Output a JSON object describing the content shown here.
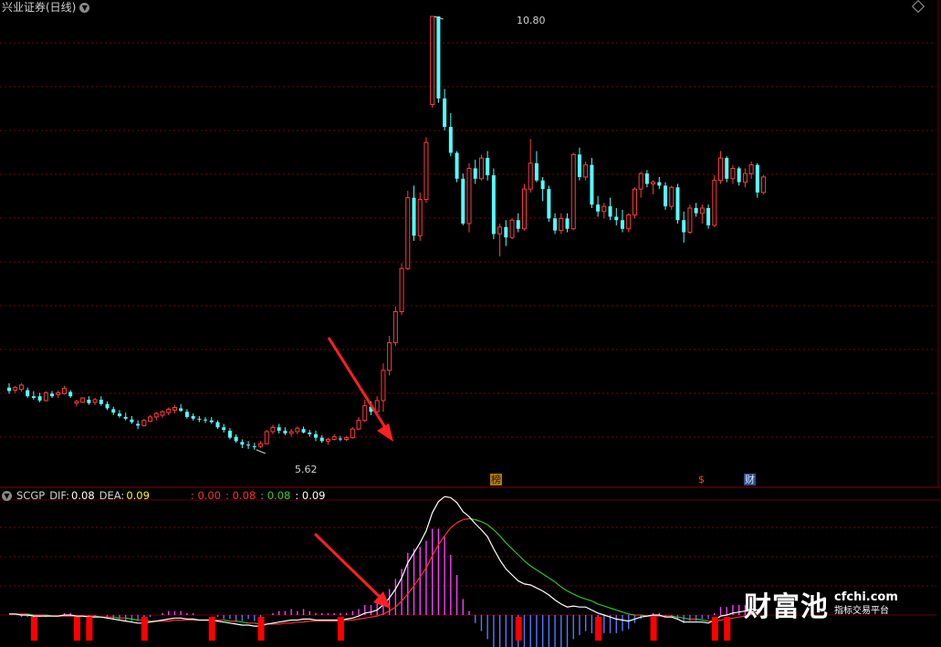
{
  "window": {
    "title": "兴业证券(日线)"
  },
  "indicator": {
    "name": "SCGP",
    "dif_label": "DIF:",
    "dif_value": "0.08",
    "dea_label": "DEA:",
    "dea_value": "0.09",
    "v1": ": 0.00",
    "v2": ": 0.08",
    "v3": ": 0.08",
    "v4": ": 0.09"
  },
  "price_labels": {
    "high": "10.80",
    "low": "5.62"
  },
  "markers": {
    "bang": "榜",
    "dollar": "$",
    "cai": "财"
  },
  "watermark": {
    "big": "财富池",
    "url": "cfchi.com",
    "tag": "指标交易平台"
  },
  "colors": {
    "up": "#ff3c3c",
    "down": "#54ffff",
    "grid": "#7a0000",
    "dif": "#ffffff",
    "dea": "#ffff00",
    "hist_pos": "#ff3cff",
    "hist_neg": "#4f7bff",
    "signal": "#ff0000",
    "arrow": "#ff2020"
  },
  "chart_data": {
    "type": "candlestick",
    "price_range": [
      5.62,
      10.8
    ],
    "candles": [
      [
        6.5,
        6.55,
        6.43,
        6.46
      ],
      [
        6.47,
        6.52,
        6.44,
        6.5
      ],
      [
        6.48,
        6.55,
        6.45,
        6.53
      ],
      [
        6.47,
        6.5,
        6.38,
        6.4
      ],
      [
        6.4,
        6.46,
        6.36,
        6.38
      ],
      [
        6.4,
        6.44,
        6.33,
        6.35
      ],
      [
        6.35,
        6.46,
        6.34,
        6.44
      ],
      [
        6.43,
        6.46,
        6.38,
        6.4
      ],
      [
        6.42,
        6.47,
        6.38,
        6.44
      ],
      [
        6.43,
        6.52,
        6.42,
        6.49
      ],
      [
        6.45,
        6.47,
        6.38,
        6.4
      ],
      [
        6.32,
        6.36,
        6.28,
        6.34
      ],
      [
        6.33,
        6.39,
        6.32,
        6.38
      ],
      [
        6.36,
        6.4,
        6.3,
        6.32
      ],
      [
        6.33,
        6.38,
        6.3,
        6.36
      ],
      [
        6.36,
        6.4,
        6.29,
        6.31
      ],
      [
        6.31,
        6.34,
        6.24,
        6.26
      ],
      [
        6.25,
        6.28,
        6.18,
        6.21
      ],
      [
        6.2,
        6.24,
        6.15,
        6.17
      ],
      [
        6.16,
        6.21,
        6.12,
        6.14
      ],
      [
        6.13,
        6.17,
        6.08,
        6.1
      ],
      [
        6.08,
        6.12,
        6.02,
        6.06
      ],
      [
        6.06,
        6.14,
        6.05,
        6.12
      ],
      [
        6.11,
        6.18,
        6.1,
        6.16
      ],
      [
        6.16,
        6.22,
        6.12,
        6.2
      ],
      [
        6.18,
        6.24,
        6.15,
        6.22
      ],
      [
        6.21,
        6.27,
        6.18,
        6.25
      ],
      [
        6.24,
        6.3,
        6.2,
        6.27
      ],
      [
        6.26,
        6.31,
        6.22,
        6.23
      ],
      [
        6.22,
        6.25,
        6.14,
        6.16
      ],
      [
        6.17,
        6.2,
        6.12,
        6.14
      ],
      [
        6.14,
        6.17,
        6.1,
        6.13
      ],
      [
        6.13,
        6.16,
        6.09,
        6.12
      ],
      [
        6.12,
        6.16,
        6.08,
        6.1
      ],
      [
        6.1,
        6.12,
        6.02,
        6.04
      ],
      [
        6.04,
        6.08,
        5.98,
        6.01
      ],
      [
        6.0,
        6.03,
        5.9,
        5.92
      ],
      [
        5.93,
        5.96,
        5.86,
        5.88
      ],
      [
        5.87,
        5.9,
        5.8,
        5.84
      ],
      [
        5.84,
        5.88,
        5.79,
        5.83
      ],
      [
        5.82,
        5.86,
        5.78,
        5.81
      ],
      [
        5.82,
        5.88,
        5.8,
        5.85
      ],
      [
        5.85,
        6.01,
        5.84,
        5.99
      ],
      [
        5.99,
        6.07,
        5.96,
        6.04
      ],
      [
        6.04,
        6.08,
        5.97,
        6.0
      ],
      [
        6.0,
        6.04,
        5.95,
        5.97
      ],
      [
        5.97,
        6.02,
        5.93,
        5.99
      ],
      [
        5.99,
        6.05,
        5.96,
        6.03
      ],
      [
        6.02,
        6.05,
        5.97,
        5.98
      ],
      [
        5.98,
        6.01,
        5.93,
        5.96
      ],
      [
        5.96,
        6.0,
        5.88,
        5.92
      ],
      [
        5.92,
        5.95,
        5.86,
        5.88
      ],
      [
        5.88,
        5.92,
        5.84,
        5.9
      ],
      [
        5.9,
        5.96,
        5.89,
        5.93
      ],
      [
        5.91,
        5.94,
        5.88,
        5.9
      ],
      [
        5.9,
        5.94,
        5.88,
        5.92
      ],
      [
        5.92,
        6.04,
        5.91,
        6.02
      ],
      [
        6.02,
        6.16,
        6.01,
        6.12
      ],
      [
        6.12,
        6.36,
        6.1,
        6.29
      ],
      [
        6.28,
        6.34,
        6.18,
        6.22
      ],
      [
        6.22,
        6.4,
        6.2,
        6.35
      ],
      [
        6.35,
        6.78,
        6.22,
        6.7
      ],
      [
        6.7,
        7.1,
        6.64,
        7.02
      ],
      [
        7.02,
        7.44,
        6.98,
        7.38
      ],
      [
        7.38,
        7.94,
        7.34,
        7.88
      ],
      [
        7.88,
        8.78,
        7.86,
        8.7
      ],
      [
        8.7,
        8.84,
        8.2,
        8.26
      ],
      [
        8.26,
        8.76,
        8.2,
        8.68
      ],
      [
        8.68,
        9.4,
        8.64,
        9.34
      ],
      [
        9.78,
        10.8,
        9.74,
        10.8
      ],
      [
        10.8,
        10.8,
        9.8,
        9.85
      ],
      [
        9.85,
        9.96,
        9.48,
        9.52
      ],
      [
        9.52,
        9.68,
        9.18,
        9.22
      ],
      [
        9.22,
        9.24,
        8.88,
        8.92
      ],
      [
        8.92,
        8.98,
        8.38,
        8.4
      ],
      [
        8.4,
        9.1,
        8.3,
        9.04
      ],
      [
        9.04,
        9.14,
        8.86,
        8.92
      ],
      [
        8.92,
        9.2,
        8.9,
        9.16
      ],
      [
        9.16,
        9.24,
        8.9,
        8.96
      ],
      [
        8.96,
        9.04,
        8.22,
        8.28
      ],
      [
        8.28,
        8.4,
        8.02,
        8.36
      ],
      [
        8.36,
        8.44,
        8.14,
        8.24
      ],
      [
        8.24,
        8.46,
        8.22,
        8.44
      ],
      [
        8.44,
        8.52,
        8.3,
        8.34
      ],
      [
        8.34,
        8.86,
        8.32,
        8.8
      ],
      [
        8.8,
        9.38,
        8.76,
        9.1
      ],
      [
        9.1,
        9.24,
        8.88,
        8.9
      ],
      [
        8.9,
        8.94,
        8.66,
        8.8
      ],
      [
        8.8,
        8.84,
        8.42,
        8.46
      ],
      [
        8.46,
        8.52,
        8.28,
        8.32
      ],
      [
        8.32,
        8.52,
        8.28,
        8.46
      ],
      [
        8.46,
        8.52,
        8.3,
        8.34
      ],
      [
        8.34,
        9.22,
        8.32,
        9.2
      ],
      [
        9.2,
        9.28,
        8.9,
        8.94
      ],
      [
        8.94,
        9.12,
        8.9,
        9.08
      ],
      [
        9.08,
        9.16,
        8.58,
        8.62
      ],
      [
        8.62,
        8.72,
        8.48,
        8.54
      ],
      [
        8.54,
        8.64,
        8.46,
        8.6
      ],
      [
        8.6,
        8.7,
        8.44,
        8.48
      ],
      [
        8.48,
        8.58,
        8.38,
        8.44
      ],
      [
        8.44,
        8.56,
        8.3,
        8.34
      ],
      [
        8.34,
        8.52,
        8.3,
        8.5
      ],
      [
        8.5,
        8.82,
        8.46,
        8.8
      ],
      [
        8.8,
        9.0,
        8.7,
        8.98
      ],
      [
        8.98,
        9.02,
        8.82,
        8.86
      ],
      [
        8.86,
        8.9,
        8.74,
        8.88
      ],
      [
        8.88,
        8.94,
        8.8,
        8.84
      ],
      [
        8.84,
        8.88,
        8.56,
        8.6
      ],
      [
        8.6,
        8.84,
        8.56,
        8.82
      ],
      [
        8.82,
        8.86,
        8.4,
        8.44
      ],
      [
        8.44,
        8.54,
        8.18,
        8.3
      ],
      [
        8.3,
        8.62,
        8.28,
        8.58
      ],
      [
        8.58,
        8.64,
        8.48,
        8.52
      ],
      [
        8.52,
        8.62,
        8.4,
        8.58
      ],
      [
        8.58,
        8.62,
        8.34,
        8.38
      ],
      [
        8.38,
        8.96,
        8.36,
        8.9
      ],
      [
        8.9,
        9.24,
        8.86,
        9.16
      ],
      [
        9.16,
        9.18,
        8.88,
        8.92
      ],
      [
        8.92,
        9.08,
        8.86,
        9.04
      ],
      [
        9.04,
        9.06,
        8.84,
        8.88
      ],
      [
        8.88,
        9.04,
        8.82,
        8.98
      ],
      [
        8.98,
        9.12,
        8.92,
        9.08
      ],
      [
        9.08,
        9.1,
        8.7,
        8.76
      ],
      [
        8.76,
        8.96,
        8.74,
        8.94
      ]
    ],
    "dif": [
      0.01,
      0.01,
      0.0,
      0.0,
      -0.01,
      -0.01,
      -0.01,
      -0.01,
      -0.01,
      0.0,
      0.0,
      -0.01,
      -0.01,
      -0.02,
      -0.02,
      -0.02,
      -0.03,
      -0.04,
      -0.05,
      -0.06,
      -0.07,
      -0.08,
      -0.08,
      -0.07,
      -0.06,
      -0.05,
      -0.04,
      -0.03,
      -0.03,
      -0.04,
      -0.04,
      -0.05,
      -0.05,
      -0.05,
      -0.06,
      -0.07,
      -0.08,
      -0.09,
      -0.1,
      -0.1,
      -0.11,
      -0.11,
      -0.09,
      -0.08,
      -0.07,
      -0.06,
      -0.05,
      -0.05,
      -0.04,
      -0.04,
      -0.05,
      -0.05,
      -0.05,
      -0.05,
      -0.05,
      -0.04,
      -0.03,
      -0.01,
      0.02,
      0.03,
      0.05,
      0.1,
      0.17,
      0.26,
      0.37,
      0.52,
      0.62,
      0.72,
      0.84,
      1.02,
      1.13,
      1.18,
      1.17,
      1.12,
      1.03,
      0.98,
      0.91,
      0.85,
      0.78,
      0.66,
      0.55,
      0.46,
      0.4,
      0.34,
      0.31,
      0.3,
      0.27,
      0.24,
      0.2,
      0.15,
      0.11,
      0.08,
      0.09,
      0.08,
      0.08,
      0.05,
      0.02,
      0.0,
      -0.02,
      -0.04,
      -0.05,
      -0.06,
      -0.04,
      -0.02,
      -0.01,
      0.0,
      0.0,
      -0.02,
      -0.02,
      -0.04,
      -0.07,
      -0.07,
      -0.07,
      -0.07,
      -0.08,
      -0.05,
      -0.01,
      0.0,
      0.02,
      0.03,
      0.04,
      0.06,
      0.05,
      0.08
    ],
    "dea": [
      0.01,
      0.01,
      0.01,
      0.01,
      0.0,
      0.0,
      0.0,
      -0.01,
      -0.01,
      -0.01,
      -0.01,
      -0.01,
      -0.01,
      -0.01,
      -0.01,
      -0.02,
      -0.02,
      -0.02,
      -0.03,
      -0.03,
      -0.04,
      -0.05,
      -0.05,
      -0.06,
      -0.06,
      -0.06,
      -0.06,
      -0.05,
      -0.05,
      -0.05,
      -0.05,
      -0.05,
      -0.05,
      -0.05,
      -0.05,
      -0.05,
      -0.06,
      -0.06,
      -0.07,
      -0.08,
      -0.08,
      -0.09,
      -0.09,
      -0.09,
      -0.09,
      -0.08,
      -0.08,
      -0.07,
      -0.07,
      -0.06,
      -0.06,
      -0.06,
      -0.06,
      -0.06,
      -0.06,
      -0.05,
      -0.05,
      -0.04,
      -0.03,
      -0.02,
      -0.01,
      0.01,
      0.04,
      0.08,
      0.14,
      0.21,
      0.29,
      0.38,
      0.47,
      0.59,
      0.7,
      0.79,
      0.87,
      0.92,
      0.95,
      0.96,
      0.95,
      0.93,
      0.9,
      0.85,
      0.79,
      0.72,
      0.66,
      0.6,
      0.54,
      0.49,
      0.45,
      0.41,
      0.37,
      0.33,
      0.28,
      0.24,
      0.21,
      0.18,
      0.16,
      0.14,
      0.11,
      0.09,
      0.07,
      0.05,
      0.03,
      0.01,
      0.0,
      0.0,
      -0.01,
      -0.01,
      -0.01,
      -0.01,
      -0.01,
      -0.02,
      -0.03,
      -0.04,
      -0.04,
      -0.05,
      -0.06,
      -0.06,
      -0.05,
      -0.04,
      -0.03,
      -0.02,
      -0.01,
      0.01,
      0.03,
      0.09
    ],
    "signal_bars": [
      4,
      11,
      13,
      22,
      33,
      41,
      54,
      83,
      96,
      105,
      115,
      117
    ]
  }
}
